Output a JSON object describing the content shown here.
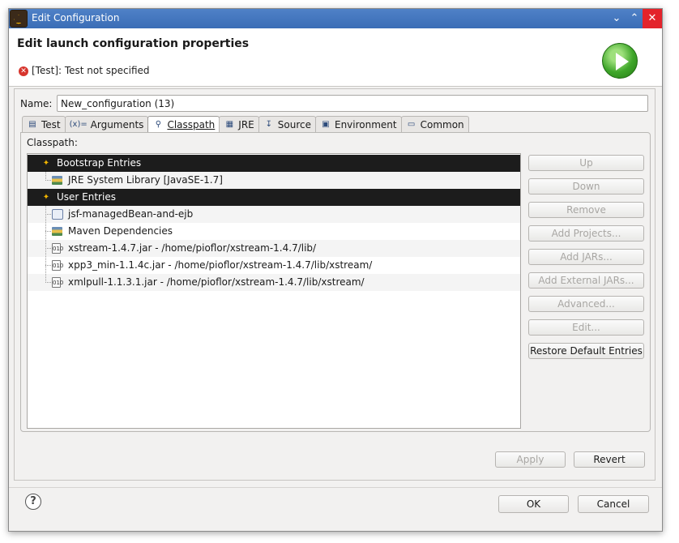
{
  "window": {
    "title": "Edit Configuration",
    "min_glyph": "⌄",
    "max_glyph": "⌃",
    "close_glyph": "✕"
  },
  "header": {
    "title": "Edit launch configuration properties",
    "error_text": "[Test]: Test not specified",
    "error_icon": "error-icon",
    "run_icon": "run-icon"
  },
  "name": {
    "label": "Name:",
    "value": "New_configuration (13)"
  },
  "tabs": [
    {
      "label": "Test",
      "icon": "test-icon",
      "glyph": "▤"
    },
    {
      "label": "Arguments",
      "icon": "arguments-icon",
      "glyph": "(x)="
    },
    {
      "label": "Classpath",
      "icon": "classpath-icon",
      "glyph": "⚲",
      "active": true
    },
    {
      "label": "JRE",
      "icon": "jre-icon",
      "glyph": "▦"
    },
    {
      "label": "Source",
      "icon": "source-icon",
      "glyph": "↧"
    },
    {
      "label": "Environment",
      "icon": "environment-icon",
      "glyph": "▣"
    },
    {
      "label": "Common",
      "icon": "common-icon",
      "glyph": "▭"
    }
  ],
  "classpath": {
    "label": "Classpath:",
    "entries": [
      {
        "label": "Bootstrap Entries",
        "type": "category",
        "icon": "category-icon",
        "selected": true
      },
      {
        "label": "JRE System Library [JavaSE-1.7]",
        "type": "library",
        "icon": "library-icon"
      },
      {
        "label": "User Entries",
        "type": "category",
        "icon": "category-icon",
        "selected": true
      },
      {
        "label": "jsf-managedBean-and-ejb",
        "type": "project",
        "icon": "project-icon"
      },
      {
        "label": "Maven Dependencies",
        "type": "library",
        "icon": "library-icon"
      },
      {
        "label": "xstream-1.4.7.jar - /home/pioflor/xstream-1.4.7/lib/",
        "type": "jar",
        "icon": "jar-icon"
      },
      {
        "label": "xpp3_min-1.1.4c.jar - /home/pioflor/xstream-1.4.7/lib/xstream/",
        "type": "jar",
        "icon": "jar-icon"
      },
      {
        "label": "xmlpull-1.1.3.1.jar - /home/pioflor/xstream-1.4.7/lib/xstream/",
        "type": "jar",
        "icon": "jar-icon"
      }
    ]
  },
  "side_buttons": [
    {
      "label": "Up",
      "enabled": false
    },
    {
      "label": "Down",
      "enabled": false
    },
    {
      "label": "Remove",
      "enabled": false
    },
    {
      "label": "Add Projects...",
      "enabled": false
    },
    {
      "label": "Add JARs...",
      "enabled": false
    },
    {
      "label": "Add External JARs...",
      "enabled": false
    },
    {
      "label": "Advanced...",
      "enabled": false
    },
    {
      "label": "Edit...",
      "enabled": false
    },
    {
      "label": "Restore Default Entries",
      "enabled": true
    }
  ],
  "apply_label": "Apply",
  "revert_label": "Revert",
  "ok_label": "OK",
  "cancel_label": "Cancel",
  "help_glyph": "?",
  "error_glyph": "✕",
  "colors": {
    "titlebar": "#3a6db6",
    "close_button": "#e3232b",
    "selection": "#1c1c1c",
    "error": "#d7352d",
    "run_green": "#3fa62a"
  }
}
